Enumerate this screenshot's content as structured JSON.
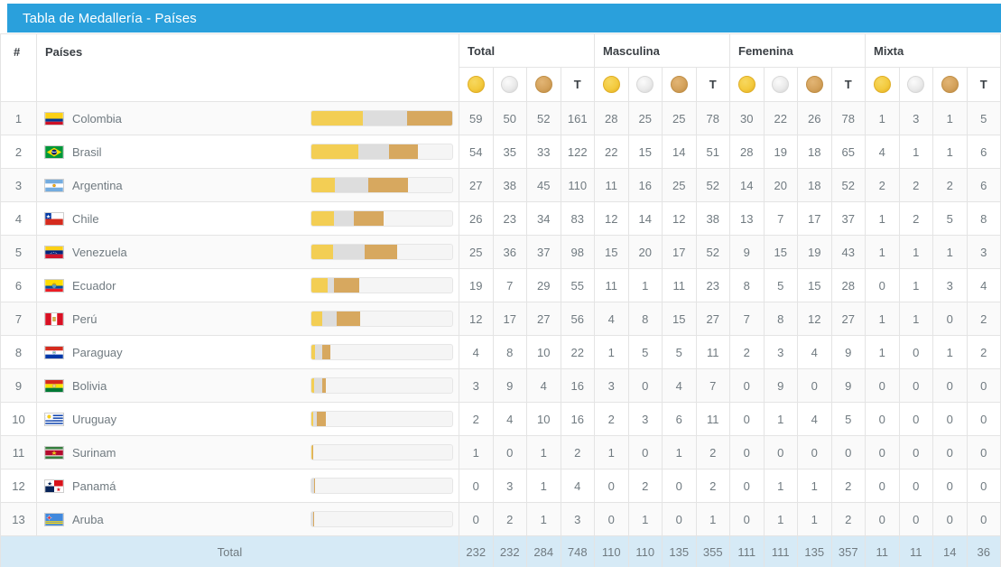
{
  "panel": {
    "title": "Tabla de Medallería - Países"
  },
  "header": {
    "rank": "#",
    "country": "Países",
    "groups": [
      "Total",
      "Masculina",
      "Femenina",
      "Mixta"
    ],
    "medal_icons": [
      "gold-medal-icon",
      "silver-medal-icon",
      "bronze-medal-icon"
    ],
    "total_abbr": "T"
  },
  "chart_data": {
    "type": "table",
    "title": "Tabla de Medallería - Países",
    "bar_scale_max": 161,
    "column_groups": [
      "Total",
      "Masculina",
      "Femenina",
      "Mixta"
    ],
    "columns_per_group": [
      "Oro",
      "Plata",
      "Bronce",
      "T"
    ],
    "categories": [
      "Colombia",
      "Brasil",
      "Argentina",
      "Chile",
      "Venezuela",
      "Ecuador",
      "Perú",
      "Paraguay",
      "Bolivia",
      "Uruguay",
      "Surinam",
      "Panamá",
      "Aruba"
    ],
    "series": [
      {
        "name": "Total Oro",
        "values": [
          59,
          54,
          27,
          26,
          25,
          19,
          12,
          4,
          3,
          2,
          1,
          0,
          0
        ]
      },
      {
        "name": "Total Plata",
        "values": [
          50,
          35,
          38,
          23,
          36,
          7,
          17,
          8,
          9,
          4,
          0,
          3,
          2
        ]
      },
      {
        "name": "Total Bronce",
        "values": [
          52,
          33,
          45,
          34,
          37,
          29,
          27,
          10,
          4,
          10,
          1,
          1,
          1
        ]
      },
      {
        "name": "Total T",
        "values": [
          161,
          122,
          110,
          83,
          98,
          55,
          56,
          22,
          16,
          16,
          2,
          4,
          3
        ]
      },
      {
        "name": "Masculina Oro",
        "values": [
          28,
          22,
          11,
          12,
          15,
          11,
          4,
          1,
          3,
          2,
          1,
          0,
          0
        ]
      },
      {
        "name": "Masculina Plata",
        "values": [
          25,
          15,
          16,
          14,
          20,
          1,
          8,
          5,
          0,
          3,
          0,
          2,
          1
        ]
      },
      {
        "name": "Masculina Bronce",
        "values": [
          25,
          14,
          25,
          12,
          17,
          11,
          15,
          5,
          4,
          6,
          1,
          0,
          0
        ]
      },
      {
        "name": "Masculina T",
        "values": [
          78,
          51,
          52,
          38,
          52,
          23,
          27,
          11,
          7,
          11,
          2,
          2,
          1
        ]
      },
      {
        "name": "Femenina Oro",
        "values": [
          30,
          28,
          14,
          13,
          9,
          8,
          7,
          2,
          0,
          0,
          0,
          0,
          0
        ]
      },
      {
        "name": "Femenina Plata",
        "values": [
          22,
          19,
          20,
          7,
          15,
          5,
          8,
          3,
          9,
          1,
          0,
          1,
          1
        ]
      },
      {
        "name": "Femenina Bronce",
        "values": [
          26,
          18,
          18,
          17,
          19,
          15,
          12,
          4,
          0,
          4,
          0,
          1,
          1
        ]
      },
      {
        "name": "Femenina T",
        "values": [
          78,
          65,
          52,
          37,
          43,
          28,
          27,
          9,
          9,
          5,
          0,
          2,
          2
        ]
      },
      {
        "name": "Mixta Oro",
        "values": [
          1,
          4,
          2,
          1,
          1,
          0,
          1,
          1,
          0,
          0,
          0,
          0,
          0
        ]
      },
      {
        "name": "Mixta Plata",
        "values": [
          3,
          1,
          2,
          2,
          1,
          1,
          1,
          0,
          0,
          0,
          0,
          0,
          0
        ]
      },
      {
        "name": "Mixta Bronce",
        "values": [
          1,
          1,
          2,
          5,
          1,
          3,
          0,
          1,
          0,
          0,
          0,
          0,
          0
        ]
      },
      {
        "name": "Mixta T",
        "values": [
          5,
          6,
          6,
          8,
          3,
          4,
          2,
          2,
          0,
          0,
          0,
          0,
          0
        ]
      }
    ],
    "totals": [
      232,
      232,
      284,
      748,
      110,
      110,
      135,
      355,
      111,
      111,
      135,
      357,
      11,
      11,
      14,
      36
    ]
  },
  "rows": [
    {
      "rank": "1",
      "country": "Colombia",
      "flag": "flag-colombia",
      "bar": {
        "gold": 59,
        "silver": 50,
        "bronze": 52
      },
      "nums": [
        "59",
        "50",
        "52",
        "161",
        "28",
        "25",
        "25",
        "78",
        "30",
        "22",
        "26",
        "78",
        "1",
        "3",
        "1",
        "5"
      ]
    },
    {
      "rank": "2",
      "country": "Brasil",
      "flag": "flag-brasil",
      "bar": {
        "gold": 54,
        "silver": 35,
        "bronze": 33
      },
      "nums": [
        "54",
        "35",
        "33",
        "122",
        "22",
        "15",
        "14",
        "51",
        "28",
        "19",
        "18",
        "65",
        "4",
        "1",
        "1",
        "6"
      ]
    },
    {
      "rank": "3",
      "country": "Argentina",
      "flag": "flag-argentina",
      "bar": {
        "gold": 27,
        "silver": 38,
        "bronze": 45
      },
      "nums": [
        "27",
        "38",
        "45",
        "110",
        "11",
        "16",
        "25",
        "52",
        "14",
        "20",
        "18",
        "52",
        "2",
        "2",
        "2",
        "6"
      ]
    },
    {
      "rank": "4",
      "country": "Chile",
      "flag": "flag-chile",
      "bar": {
        "gold": 26,
        "silver": 23,
        "bronze": 34
      },
      "nums": [
        "26",
        "23",
        "34",
        "83",
        "12",
        "14",
        "12",
        "38",
        "13",
        "7",
        "17",
        "37",
        "1",
        "2",
        "5",
        "8"
      ]
    },
    {
      "rank": "5",
      "country": "Venezuela",
      "flag": "flag-venezuela",
      "bar": {
        "gold": 25,
        "silver": 36,
        "bronze": 37
      },
      "nums": [
        "25",
        "36",
        "37",
        "98",
        "15",
        "20",
        "17",
        "52",
        "9",
        "15",
        "19",
        "43",
        "1",
        "1",
        "1",
        "3"
      ]
    },
    {
      "rank": "6",
      "country": "Ecuador",
      "flag": "flag-ecuador",
      "bar": {
        "gold": 19,
        "silver": 7,
        "bronze": 29
      },
      "nums": [
        "19",
        "7",
        "29",
        "55",
        "11",
        "1",
        "11",
        "23",
        "8",
        "5",
        "15",
        "28",
        "0",
        "1",
        "3",
        "4"
      ]
    },
    {
      "rank": "7",
      "country": "Perú",
      "flag": "flag-peru",
      "bar": {
        "gold": 12,
        "silver": 17,
        "bronze": 27
      },
      "nums": [
        "12",
        "17",
        "27",
        "56",
        "4",
        "8",
        "15",
        "27",
        "7",
        "8",
        "12",
        "27",
        "1",
        "1",
        "0",
        "2"
      ]
    },
    {
      "rank": "8",
      "country": "Paraguay",
      "flag": "flag-paraguay",
      "bar": {
        "gold": 4,
        "silver": 8,
        "bronze": 10
      },
      "nums": [
        "4",
        "8",
        "10",
        "22",
        "1",
        "5",
        "5",
        "11",
        "2",
        "3",
        "4",
        "9",
        "1",
        "0",
        "1",
        "2"
      ]
    },
    {
      "rank": "9",
      "country": "Bolivia",
      "flag": "flag-bolivia",
      "bar": {
        "gold": 3,
        "silver": 9,
        "bronze": 4
      },
      "nums": [
        "3",
        "9",
        "4",
        "16",
        "3",
        "0",
        "4",
        "7",
        "0",
        "9",
        "0",
        "9",
        "0",
        "0",
        "0",
        "0"
      ]
    },
    {
      "rank": "10",
      "country": "Uruguay",
      "flag": "flag-uruguay",
      "bar": {
        "gold": 2,
        "silver": 4,
        "bronze": 10
      },
      "nums": [
        "2",
        "4",
        "10",
        "16",
        "2",
        "3",
        "6",
        "11",
        "0",
        "1",
        "4",
        "5",
        "0",
        "0",
        "0",
        "0"
      ]
    },
    {
      "rank": "11",
      "country": "Surinam",
      "flag": "flag-surinam",
      "bar": {
        "gold": 1,
        "silver": 0,
        "bronze": 1
      },
      "nums": [
        "1",
        "0",
        "1",
        "2",
        "1",
        "0",
        "1",
        "2",
        "0",
        "0",
        "0",
        "0",
        "0",
        "0",
        "0",
        "0"
      ]
    },
    {
      "rank": "12",
      "country": "Panamá",
      "flag": "flag-panama",
      "bar": {
        "gold": 0,
        "silver": 3,
        "bronze": 1
      },
      "nums": [
        "0",
        "3",
        "1",
        "4",
        "0",
        "2",
        "0",
        "2",
        "0",
        "1",
        "1",
        "2",
        "0",
        "0",
        "0",
        "0"
      ]
    },
    {
      "rank": "13",
      "country": "Aruba",
      "flag": "flag-aruba",
      "bar": {
        "gold": 0,
        "silver": 2,
        "bronze": 1
      },
      "nums": [
        "0",
        "2",
        "1",
        "3",
        "0",
        "1",
        "0",
        "1",
        "0",
        "1",
        "1",
        "2",
        "0",
        "0",
        "0",
        "0"
      ]
    }
  ],
  "footer": {
    "label": "Total",
    "nums": [
      "232",
      "232",
      "284",
      "748",
      "110",
      "110",
      "135",
      "355",
      "111",
      "111",
      "135",
      "357",
      "11",
      "11",
      "14",
      "36"
    ]
  },
  "colors": {
    "header_bar": "#2aa0dc",
    "gold": "#f3ce54",
    "silver": "#dddddd",
    "bronze": "#d7a85f",
    "footer_bg": "#d6eaf6"
  }
}
